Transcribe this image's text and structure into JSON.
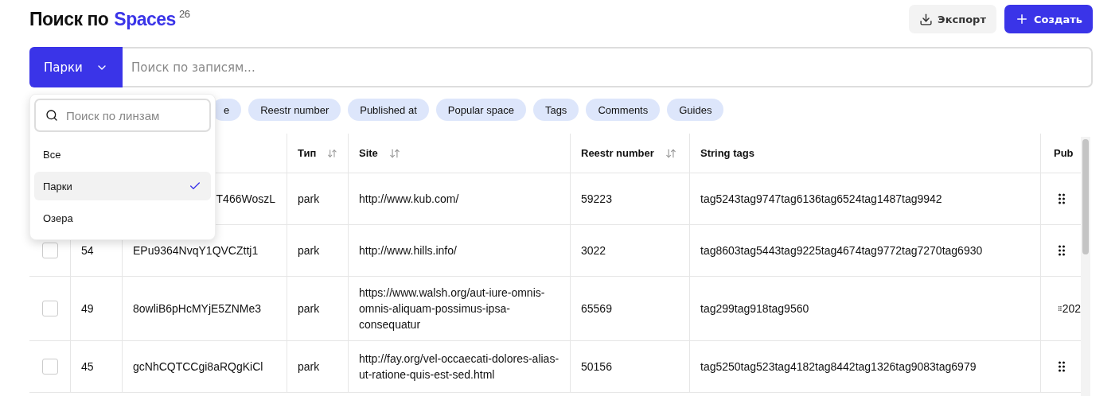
{
  "title": {
    "prefix": "Поиск по",
    "highlight": "Spaces",
    "count": "26"
  },
  "actions": [
    {
      "kind": "export",
      "label": "Экспорт"
    },
    {
      "kind": "create",
      "label": "Создать"
    }
  ],
  "lens": {
    "label": "Парки",
    "expanded": true
  },
  "search": {
    "placeholder": "Поиск по записям..."
  },
  "lens_menu": {
    "search_placeholder": "Поиск по линзам",
    "items": [
      {
        "label": "Все",
        "selected": false
      },
      {
        "label": "Парки",
        "selected": true
      },
      {
        "label": "Озера",
        "selected": false
      }
    ]
  },
  "column_chips": [
    "e",
    "Reestr number",
    "Published at",
    "Popular space",
    "Tags",
    "Comments",
    "Guides"
  ],
  "table": {
    "columns": [
      {
        "label": "Тип",
        "sortable": true
      },
      {
        "label": "Site",
        "sortable": true
      },
      {
        "label": "Reestr number",
        "sortable": true
      },
      {
        "label": "String tags",
        "sortable": false
      },
      {
        "label": "Pub"
      }
    ],
    "rows": [
      {
        "code": "T466WoszL",
        "type": "park",
        "site": "http://www.kub.com/",
        "reestr": "59223",
        "tags": "tag5243tag9747tag6136tag6524tag1487tag9942"
      },
      {
        "checked": false,
        "number": "54",
        "code": "EPu9364NvqY1QVCZttj1",
        "type": "park",
        "site": "http://www.hills.info/",
        "reestr": "3022",
        "tags": "tag8603tag5443tag9225tag4674tag9772tag7270tag6930"
      },
      {
        "checked": false,
        "number": "49",
        "code": "8owliB6pHcMYjE5ZNMe3",
        "type": "park",
        "site": "https://www.walsh.org/aut-iure-omnis-omnis-aliquam-possimus-ipsa-consequatur",
        "reestr": "65569",
        "tags": "tag299tag918tag9560",
        "pub": "202"
      },
      {
        "checked": false,
        "number": "45",
        "code": "gcNhCQTCCgi8aRQgKiCl",
        "type": "park",
        "site": "http://fay.org/vel-occaecati-dolores-alias-ut-ratione-quis-est-sed.html",
        "reestr": "50156",
        "tags": "tag5250tag523tag4182tag8442tag1326tag9083tag6979"
      }
    ]
  }
}
